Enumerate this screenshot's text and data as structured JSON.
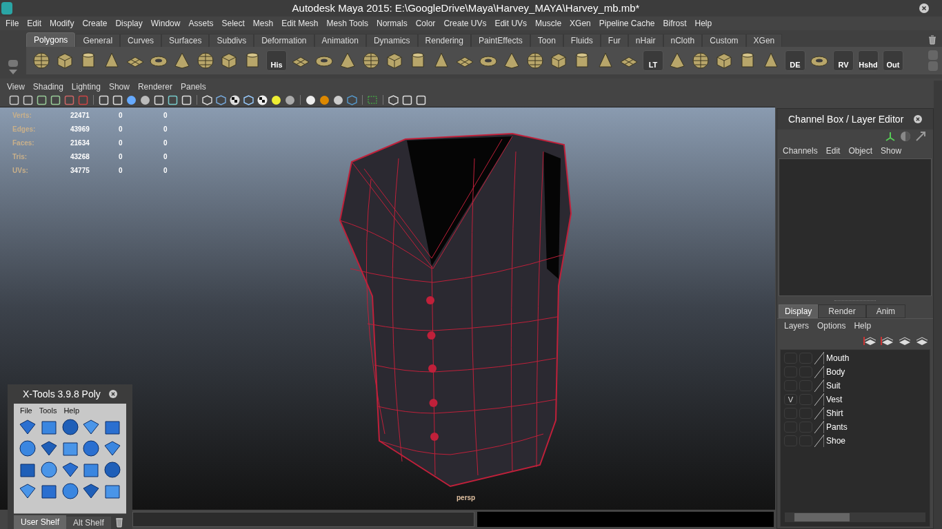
{
  "window": {
    "title": "Autodesk Maya 2015: E:\\GoogleDrive\\Maya\\Harvey_MAYA\\Harvey_mb.mb*"
  },
  "menu": [
    "File",
    "Edit",
    "Modify",
    "Create",
    "Display",
    "Window",
    "Assets",
    "Select",
    "Mesh",
    "Edit Mesh",
    "Mesh Tools",
    "Normals",
    "Color",
    "Create UVs",
    "Edit UVs",
    "Muscle",
    "XGen",
    "Pipeline Cache",
    "Bifrost",
    "Help"
  ],
  "shelf": {
    "tabs": [
      {
        "label": "Polygons",
        "selected": true
      },
      {
        "label": "General",
        "selected": false
      },
      {
        "label": "Curves",
        "selected": false
      },
      {
        "label": "Surfaces",
        "selected": false
      },
      {
        "label": "Subdivs",
        "selected": false
      },
      {
        "label": "Deformation",
        "selected": false
      },
      {
        "label": "Animation",
        "selected": false
      },
      {
        "label": "Dynamics",
        "selected": false
      },
      {
        "label": "Rendering",
        "selected": false
      },
      {
        "label": "PaintEffects",
        "selected": false
      },
      {
        "label": "Toon",
        "selected": false
      },
      {
        "label": "Fluids",
        "selected": false
      },
      {
        "label": "Fur",
        "selected": false
      },
      {
        "label": "nHair",
        "selected": false
      },
      {
        "label": "nCloth",
        "selected": false
      },
      {
        "label": "Custom",
        "selected": false
      },
      {
        "label": "XGen",
        "selected": false
      }
    ],
    "buttons": [
      {
        "kind": "icon"
      },
      {
        "kind": "icon"
      },
      {
        "kind": "icon"
      },
      {
        "kind": "icon"
      },
      {
        "kind": "icon"
      },
      {
        "kind": "icon"
      },
      {
        "kind": "icon"
      },
      {
        "kind": "icon"
      },
      {
        "kind": "icon"
      },
      {
        "kind": "icon"
      },
      {
        "kind": "labeled",
        "label": "His"
      },
      {
        "kind": "icon"
      },
      {
        "kind": "icon"
      },
      {
        "kind": "icon"
      },
      {
        "kind": "icon"
      },
      {
        "kind": "icon"
      },
      {
        "kind": "icon"
      },
      {
        "kind": "icon"
      },
      {
        "kind": "icon"
      },
      {
        "kind": "icon"
      },
      {
        "kind": "icon"
      },
      {
        "kind": "icon"
      },
      {
        "kind": "icon"
      },
      {
        "kind": "icon"
      },
      {
        "kind": "icon"
      },
      {
        "kind": "icon"
      },
      {
        "kind": "labeled",
        "label": "LT"
      },
      {
        "kind": "icon"
      },
      {
        "kind": "icon"
      },
      {
        "kind": "icon"
      },
      {
        "kind": "icon"
      },
      {
        "kind": "icon"
      },
      {
        "kind": "labeled",
        "label": "DE"
      },
      {
        "kind": "icon"
      },
      {
        "kind": "labeled",
        "label": "RV"
      },
      {
        "kind": "labeled",
        "label": "Hshd"
      },
      {
        "kind": "labeled",
        "label": "Out"
      }
    ]
  },
  "panel_menu": [
    "View",
    "Shading",
    "Lighting",
    "Show",
    "Renderer",
    "Panels"
  ],
  "hud": [
    {
      "label": "Verts:",
      "values": [
        "22471",
        "0",
        "0"
      ]
    },
    {
      "label": "Edges:",
      "values": [
        "43969",
        "0",
        "0"
      ]
    },
    {
      "label": "Faces:",
      "values": [
        "21634",
        "0",
        "0"
      ]
    },
    {
      "label": "Tris:",
      "values": [
        "43268",
        "0",
        "0"
      ]
    },
    {
      "label": "UVs:",
      "values": [
        "34775",
        "0",
        "0"
      ]
    }
  ],
  "camera": "persp",
  "channel_box": {
    "title": "Channel Box / Layer Editor",
    "menu": [
      "Channels",
      "Edit",
      "Object",
      "Show"
    ],
    "tabs": [
      {
        "label": "Display",
        "selected": true
      },
      {
        "label": "Render",
        "selected": false
      },
      {
        "label": "Anim",
        "selected": false
      }
    ],
    "layer_menu": [
      "Layers",
      "Options",
      "Help"
    ],
    "layers": [
      {
        "name": "Mouth"
      },
      {
        "name": "Body"
      },
      {
        "name": "Suit"
      },
      {
        "name": "Vest",
        "visibility": "V"
      },
      {
        "name": "Shirt"
      },
      {
        "name": "Pants"
      },
      {
        "name": "Shoe"
      }
    ]
  },
  "xtools": {
    "title": "X-Tools 3.9.8 Poly",
    "menu": [
      "File",
      "Tools",
      "Help"
    ],
    "tabs": [
      {
        "label": "User Shelf",
        "selected": true
      },
      {
        "label": "Alt Shelf",
        "selected": false
      }
    ]
  }
}
